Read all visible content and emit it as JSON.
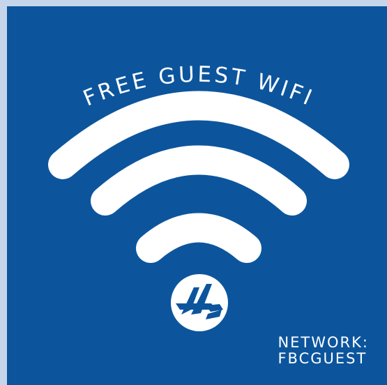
{
  "poster": {
    "headline": "FREE GUEST WIFI",
    "network_label": "NETWORK:",
    "network_name": "FBCGUEST"
  },
  "colors": {
    "background": "#0c559d",
    "frame": "#c6d6ea",
    "foreground": "#ffffff"
  },
  "icons": {
    "wifi": "wifi-icon",
    "logo": "sail-logo-icon"
  }
}
